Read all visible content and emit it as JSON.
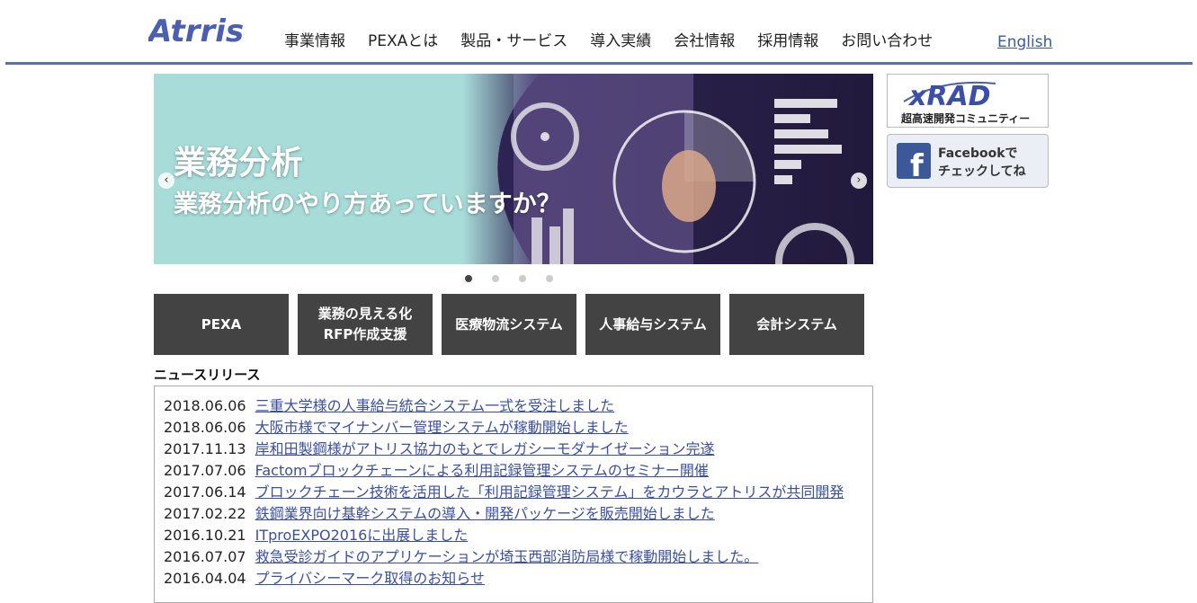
{
  "header": {
    "logo_text": "Atrris",
    "nav": [
      "事業情報",
      "PEXAとは",
      "製品・サービス",
      "導入実績",
      "会社情報",
      "採用情報",
      "お問い合わせ"
    ],
    "english_link": "English"
  },
  "slider": {
    "title": "業務分析",
    "subtitle": "業務分析のやり方あっていますか？",
    "dots": 4,
    "active_dot": 1
  },
  "side_banners": {
    "xrad_logo": "xRAD",
    "xrad_caption": "超高速開発コミュニティー",
    "facebook_line1": "Facebookで",
    "facebook_line2": "チェックしてね"
  },
  "tiles": [
    {
      "line1": "PEXA",
      "line2": ""
    },
    {
      "line1": "業務の見える化",
      "line2": "RFP作成支援"
    },
    {
      "line1": "医療物流システム",
      "line2": ""
    },
    {
      "line1": "人事給与システム",
      "line2": ""
    },
    {
      "line1": "会計システム",
      "line2": ""
    }
  ],
  "news": {
    "heading": "ニュースリリース",
    "items": [
      {
        "date": "2018.06.06",
        "title": "三重大学様の人事給与統合システム一式を受注しました"
      },
      {
        "date": "2018.06.06",
        "title": "大阪市様でマイナンバー管理システムが稼動開始しました"
      },
      {
        "date": "2017.11.13",
        "title": "岸和田製鋼様がアトリス協力のもとでレガシーモダナイゼーション完遂"
      },
      {
        "date": "2017.07.06",
        "title": "Factomブロックチェーンによる利用記録管理システムのセミナー開催"
      },
      {
        "date": "2017.06.14",
        "title": "ブロックチェーン技術を活用した「利用記録管理システム」をカウラとアトリスが共同開発"
      },
      {
        "date": "2017.02.22",
        "title": "鉄鋼業界向け基幹システムの導入・開発パッケージを販売開始しました"
      },
      {
        "date": "2016.10.21",
        "title": "ITproEXPO2016に出展しました"
      },
      {
        "date": "2016.07.07",
        "title": "救急受診ガイドのアプリケーションが埼玉西部消防局様で稼動開始しました。"
      },
      {
        "date": "2016.04.04",
        "title": "プライバシーマーク取得のお知らせ"
      }
    ]
  },
  "colors": {
    "rule": "#5b6fb5",
    "logo": "#4a5fb0",
    "tile": "#434343",
    "link": "#3a4fa0"
  }
}
